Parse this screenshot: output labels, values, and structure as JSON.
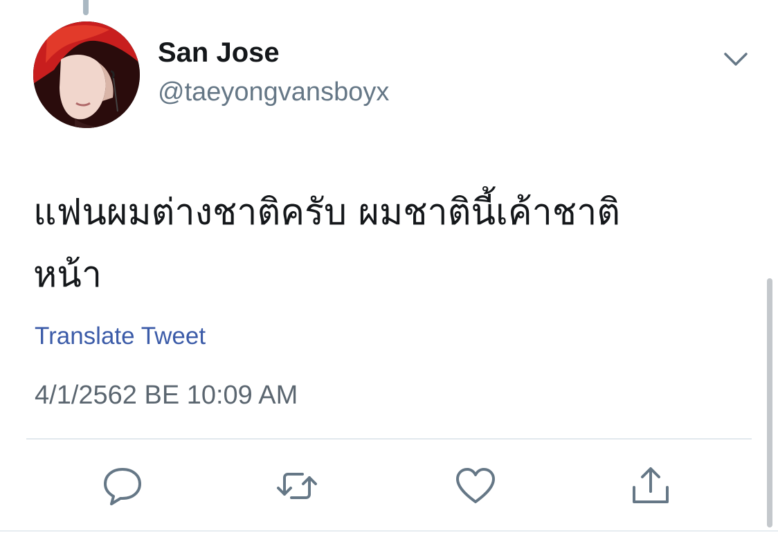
{
  "tweet": {
    "display_name": "San Jose",
    "handle": "@taeyongvansboyx",
    "text_line1": "แฟนผมต่างชาติครับ ผมชาตินี้เค้าชาติ",
    "text_line2": "หน้า",
    "translate_label": "Translate Tweet",
    "timestamp": "4/1/2562 BE 10:09 AM"
  },
  "icons": {
    "caret": "chevron-down-icon",
    "reply": "speech-bubble-icon",
    "retweet": "retweet-arrows-icon",
    "like": "heart-icon",
    "share": "share-upload-icon"
  },
  "colors": {
    "text_primary": "#14171a",
    "text_secondary": "#657786",
    "link": "#3b5ba8",
    "icon": "#657786",
    "divider": "#e1e8ed"
  }
}
